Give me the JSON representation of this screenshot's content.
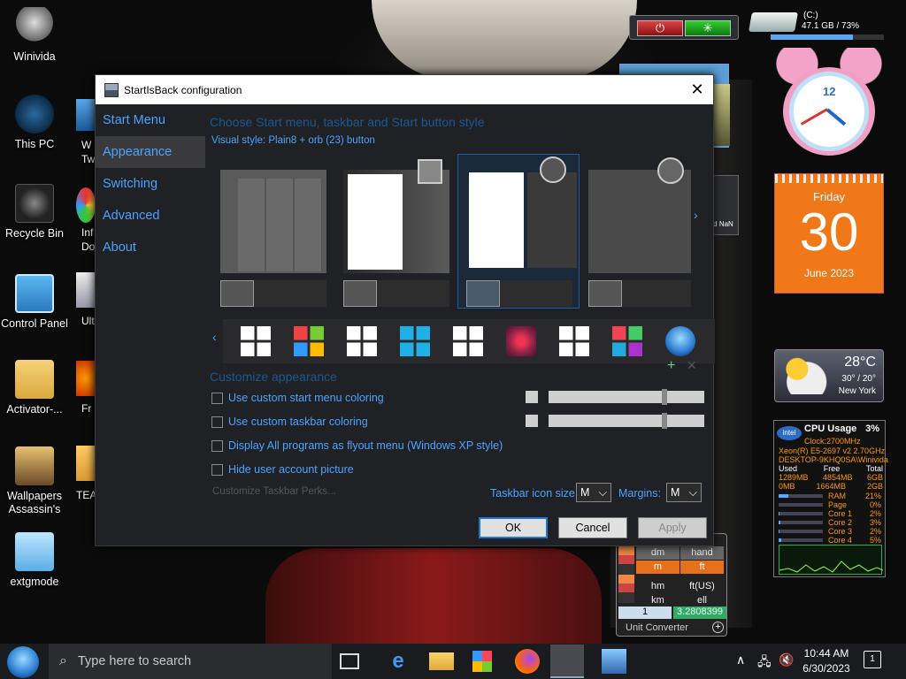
{
  "desktop": {
    "icons": [
      {
        "label": "Winivida"
      },
      {
        "label": "This PC"
      },
      {
        "label": "Recycle Bin"
      },
      {
        "label": "Control Panel"
      },
      {
        "label": "Activator-..."
      },
      {
        "label": "Wallpapers Assassin's"
      },
      {
        "label": "extgmode"
      }
    ],
    "partial_icons": [
      "W",
      "Tw",
      "Inf",
      "Do",
      "Ult",
      "Fr",
      "TEA"
    ]
  },
  "dialog": {
    "title": "StartIsBack configuration",
    "nav": [
      "Start Menu",
      "Appearance",
      "Switching",
      "Advanced",
      "About"
    ],
    "selected_nav": "Appearance",
    "heading": "Choose Start menu, taskbar and Start button style",
    "visual_style_label": "Visual style:",
    "visual_style_value": "Plain8 + orb (23) button",
    "custom_heading": "Customize appearance",
    "options": [
      "Use custom start menu coloring",
      "Use custom taskbar coloring",
      "Display All programs as flyout menu (Windows XP style)",
      "Hide user account picture"
    ],
    "customize_perks": "Customize Taskbar Perks...",
    "icon_size_label": "Taskbar icon size:",
    "icon_size_value": "M",
    "margins_label": "Margins:",
    "margins_value": "M",
    "buttons": {
      "ok": "OK",
      "cancel": "Cancel",
      "apply": "Apply"
    }
  },
  "gadgets": {
    "drive": {
      "name": "(C:)",
      "info": "47.1 GB / 73%",
      "used_percent": 73
    },
    "calendar": {
      "weekday": "Friday",
      "day": "30",
      "month_year": "June 2023"
    },
    "clock": {
      "numeral": "12"
    },
    "weather": {
      "temp": "28°C",
      "range": "30° / 20°",
      "city": "New York"
    },
    "peek_text": "d NaN",
    "cpu": {
      "title": "CPU Usage",
      "percent": "3%",
      "clock": "Clock:2700MHz",
      "model": "Xeon(R) E5-2697 v2 2.70GHz",
      "host": "DESKTOP-9KHQ0SA\\Winivida",
      "headers": [
        "Used",
        "Free",
        "Total"
      ],
      "rows": [
        [
          "1289MB",
          "4854MB",
          "6GB"
        ],
        [
          "0MB",
          "1664MB",
          "2GB"
        ]
      ],
      "meters": [
        [
          "RAM",
          "21%"
        ],
        [
          "Page",
          "0%"
        ],
        [
          "Core 1",
          "2%"
        ],
        [
          "Core 2",
          "3%"
        ],
        [
          "Core 3",
          "2%"
        ],
        [
          "Core 4",
          "5%"
        ]
      ]
    },
    "unit_converter": {
      "cells": [
        "dm",
        "hand",
        "m",
        "ft",
        "hm",
        "ft(US)",
        "km",
        "ell"
      ],
      "input": "1",
      "result": "3.2808399",
      "title": "Unit Converter"
    }
  },
  "taskbar": {
    "search_placeholder": "Type here to search",
    "time": "10:44 AM",
    "date": "6/30/2023",
    "notification_count": "1"
  },
  "colors": {
    "accent": "#4aa3ff",
    "calendar": "#f07818",
    "taskbar": "#1a1b1e"
  }
}
